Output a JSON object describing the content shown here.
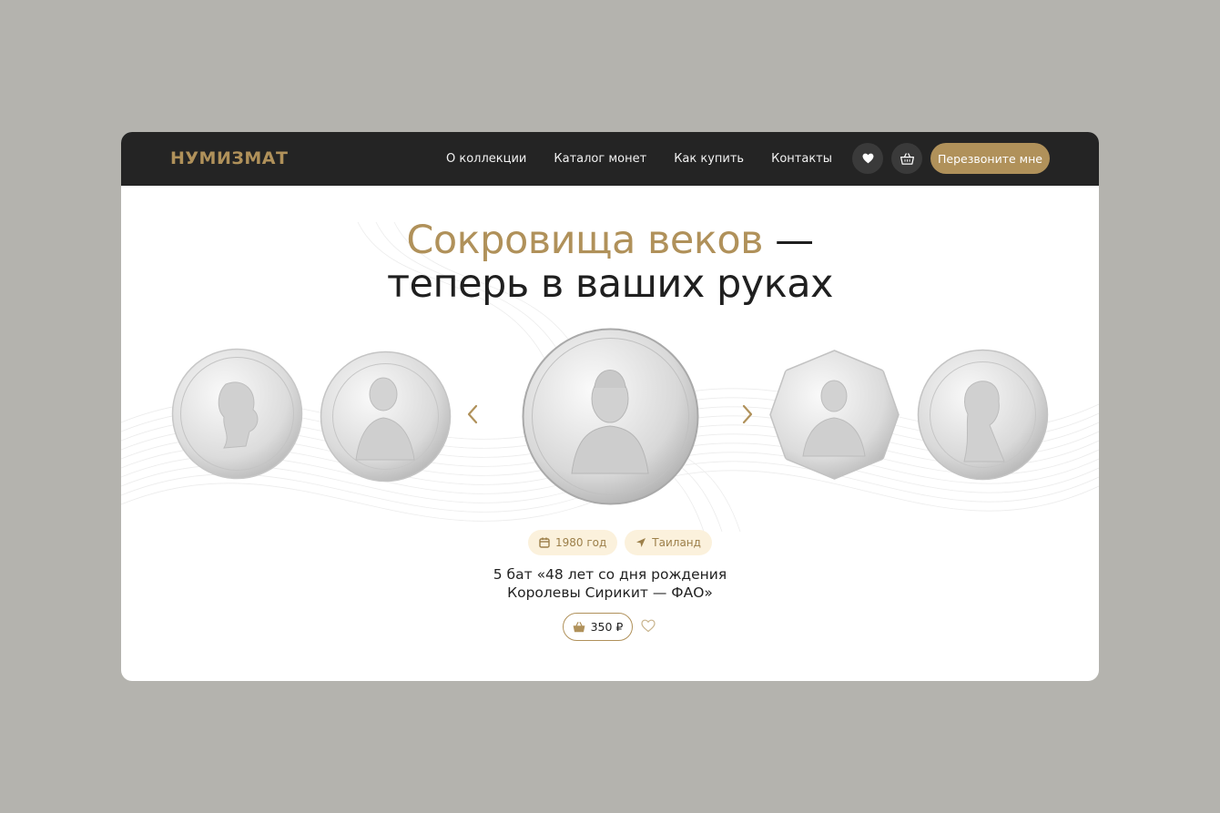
{
  "brand": {
    "logo": "НУМИЗМАТ",
    "accent": "#b0915a",
    "dark": "#242424"
  },
  "nav": {
    "items": [
      {
        "label": "О коллекции"
      },
      {
        "label": "Каталог монет"
      },
      {
        "label": "Как купить"
      },
      {
        "label": "Контакты"
      }
    ],
    "favorites_icon": "heart-icon",
    "cart_icon": "basket-icon",
    "cta_label": "Перезвоните мне"
  },
  "hero": {
    "title_accent": "Сокровища веков",
    "title_dash": " —",
    "title_line2": "теперь в ваших руках"
  },
  "carousel": {
    "prev_icon": "chevron-left-icon",
    "next_icon": "chevron-right-icon",
    "coins": [
      {
        "name": "coin-king-profile"
      },
      {
        "name": "coin-prince-portrait"
      },
      {
        "name": "coin-queen-sirikit"
      },
      {
        "name": "coin-king-uniform"
      },
      {
        "name": "coin-woman-portrait"
      }
    ]
  },
  "featured": {
    "year": "1980 год",
    "year_icon": "calendar-icon",
    "country": "Таиланд",
    "country_icon": "location-arrow-icon",
    "title_line1": "5 бат «48 лет со дня рождения",
    "title_line2": "Королевы Сирикит — ФАО»",
    "price": "350 ₽",
    "price_icon": "basket-icon",
    "favorite_icon": "heart-outline-icon"
  }
}
